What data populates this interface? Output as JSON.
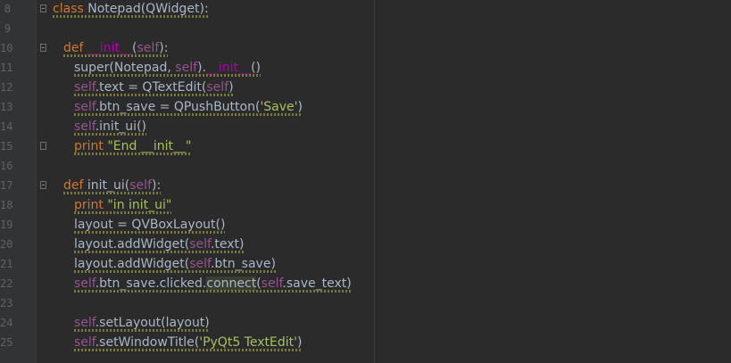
{
  "colors": {
    "background": "#2b2b2b",
    "gutter": "#313335",
    "keyword": "#cc7832",
    "self": "#94558d",
    "string": "#a5c25c",
    "dunder": "#b200b2",
    "plain": "#a9b7c6",
    "line_number": "#606366"
  },
  "lines": [
    {
      "number": "8",
      "fold": "open",
      "indent": 0,
      "tokens": [
        {
          "t": "kw",
          "s": "class "
        },
        {
          "t": "plain",
          "s": "Notepad(QWidget):"
        }
      ]
    },
    {
      "number": "9",
      "fold": "",
      "indent": 0,
      "tokens": []
    },
    {
      "number": "10",
      "fold": "open",
      "indent": 1,
      "tokens": [
        {
          "t": "kw",
          "s": "def "
        },
        {
          "t": "dunder",
          "s": "__init__"
        },
        {
          "t": "plain",
          "s": "("
        },
        {
          "t": "self",
          "s": "self"
        },
        {
          "t": "plain",
          "s": "):"
        }
      ]
    },
    {
      "number": "11",
      "fold": "",
      "indent": 2,
      "tokens": [
        {
          "t": "plain",
          "s": "super(Notepad, "
        },
        {
          "t": "self",
          "s": "self"
        },
        {
          "t": "plain",
          "s": ")."
        },
        {
          "t": "dunder",
          "s": "__init__"
        },
        {
          "t": "plain",
          "s": "()"
        }
      ]
    },
    {
      "number": "12",
      "fold": "",
      "indent": 2,
      "tokens": [
        {
          "t": "self",
          "s": "self"
        },
        {
          "t": "plain",
          "s": ".text = QTextEdit("
        },
        {
          "t": "self",
          "s": "self"
        },
        {
          "t": "plain",
          "s": ")"
        }
      ]
    },
    {
      "number": "13",
      "fold": "",
      "indent": 2,
      "tokens": [
        {
          "t": "self",
          "s": "self"
        },
        {
          "t": "plain",
          "s": ".btn_save = QPushButton("
        },
        {
          "t": "str",
          "s": "'Save'"
        },
        {
          "t": "plain",
          "s": ")"
        }
      ]
    },
    {
      "number": "14",
      "fold": "",
      "indent": 2,
      "tokens": [
        {
          "t": "self",
          "s": "self"
        },
        {
          "t": "plain",
          "s": ".init_ui()"
        }
      ]
    },
    {
      "number": "15",
      "fold": "close",
      "indent": 2,
      "tokens": [
        {
          "t": "kw",
          "s": "print "
        },
        {
          "t": "str",
          "s": "\"End __init__\""
        }
      ]
    },
    {
      "number": "16",
      "fold": "",
      "indent": 0,
      "tokens": []
    },
    {
      "number": "17",
      "fold": "open",
      "indent": 1,
      "tokens": [
        {
          "t": "kw",
          "s": "def "
        },
        {
          "t": "plain",
          "s": "init_ui("
        },
        {
          "t": "self",
          "s": "self"
        },
        {
          "t": "plain",
          "s": "):"
        }
      ]
    },
    {
      "number": "18",
      "fold": "",
      "indent": 2,
      "tokens": [
        {
          "t": "kw",
          "s": "print "
        },
        {
          "t": "str",
          "s": "\"in init_ui\""
        }
      ]
    },
    {
      "number": "19",
      "fold": "",
      "indent": 2,
      "tokens": [
        {
          "t": "plain",
          "s": "layout = QVBoxLayout()"
        }
      ]
    },
    {
      "number": "20",
      "fold": "",
      "indent": 2,
      "tokens": [
        {
          "t": "plain",
          "s": "layout.addWidget("
        },
        {
          "t": "self",
          "s": "self"
        },
        {
          "t": "plain",
          "s": ".text)"
        }
      ]
    },
    {
      "number": "21",
      "fold": "",
      "indent": 2,
      "tokens": [
        {
          "t": "plain",
          "s": "layout.addWidget("
        },
        {
          "t": "self",
          "s": "self"
        },
        {
          "t": "plain",
          "s": ".btn_save)"
        }
      ]
    },
    {
      "number": "22",
      "fold": "",
      "indent": 2,
      "tokens": [
        {
          "t": "self",
          "s": "self"
        },
        {
          "t": "plain",
          "s": ".btn_save.clicked."
        },
        {
          "t": "hl",
          "s": "connect"
        },
        {
          "t": "plain",
          "s": "("
        },
        {
          "t": "self",
          "s": "self"
        },
        {
          "t": "plain",
          "s": ".save_text)"
        }
      ]
    },
    {
      "number": "23",
      "fold": "",
      "indent": 0,
      "tokens": []
    },
    {
      "number": "24",
      "fold": "",
      "indent": 2,
      "tokens": [
        {
          "t": "self",
          "s": "self"
        },
        {
          "t": "plain",
          "s": ".setLayout(layout)"
        }
      ]
    },
    {
      "number": "25",
      "fold": "",
      "indent": 2,
      "tokens": [
        {
          "t": "self",
          "s": "self"
        },
        {
          "t": "plain",
          "s": ".setWindowTitle("
        },
        {
          "t": "str",
          "s": "'PyQt5 TextEdit'"
        },
        {
          "t": "plain",
          "s": ")"
        }
      ]
    }
  ]
}
